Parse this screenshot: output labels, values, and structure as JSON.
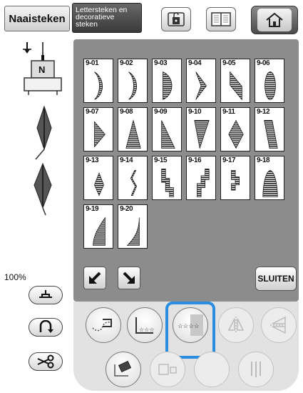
{
  "tabs": {
    "utility_label": "Naaisteken",
    "character_label_lines": [
      "Lettersteken en",
      "decoratieve",
      "steken"
    ]
  },
  "preview": {
    "foot_letter": "N",
    "zoom": "100%"
  },
  "stitches": [
    {
      "code": "9-01",
      "shape": "crescent-left"
    },
    {
      "code": "9-02",
      "shape": "crescent-left"
    },
    {
      "code": "9-03",
      "shape": "half-disk"
    },
    {
      "code": "9-04",
      "shape": "chevron"
    },
    {
      "code": "9-05",
      "shape": "parallelogram"
    },
    {
      "code": "9-06",
      "shape": "ellipse"
    },
    {
      "code": "9-07",
      "shape": "triangle-right"
    },
    {
      "code": "9-08",
      "shape": "triangle-up"
    },
    {
      "code": "9-09",
      "shape": "right-triangle"
    },
    {
      "code": "9-10",
      "shape": "wedge-down"
    },
    {
      "code": "9-11",
      "shape": "diamond"
    },
    {
      "code": "9-12",
      "shape": "slant-bar"
    },
    {
      "code": "9-13",
      "shape": "small-diamond"
    },
    {
      "code": "9-14",
      "shape": "zigzag"
    },
    {
      "code": "9-15",
      "shape": "steps-down"
    },
    {
      "code": "9-16",
      "shape": "steps-up"
    },
    {
      "code": "9-17",
      "shape": "steps-mixed"
    },
    {
      "code": "9-18",
      "shape": "dome"
    },
    {
      "code": "9-19",
      "shape": "leaf-left"
    },
    {
      "code": "9-20",
      "shape": "leaf-right"
    }
  ],
  "buttons": {
    "close_label": "SLUITEN"
  },
  "bottom": {
    "rating_stars": "☆☆☆☆",
    "stars_button": "☆☆☆"
  }
}
